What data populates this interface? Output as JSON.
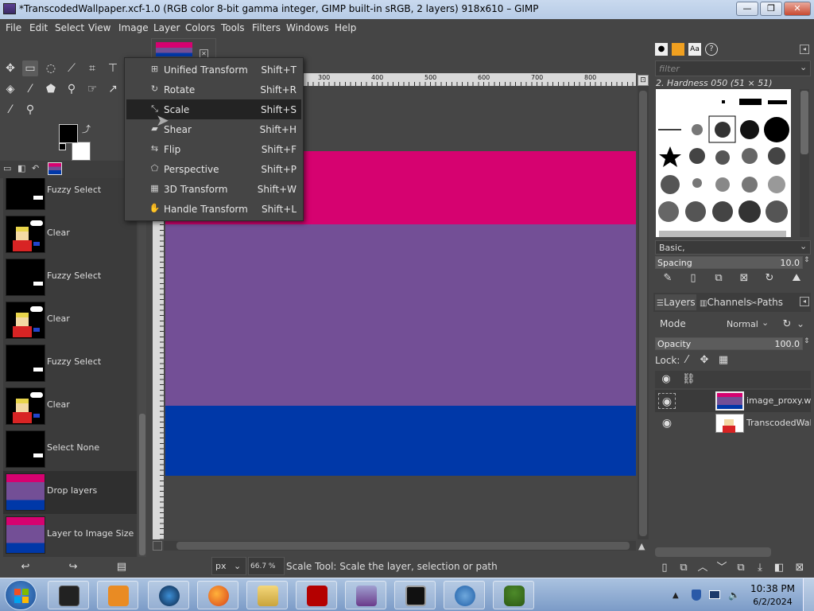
{
  "window": {
    "title": "*TranscodedWallpaper.xcf-1.0 (RGB color 8-bit gamma integer, GIMP built-in sRGB, 2 layers) 918x610 – GIMP",
    "minimize": "—",
    "maximize": "❐",
    "close": "✕"
  },
  "menubar": [
    "File",
    "Edit",
    "Select",
    "View",
    "Image",
    "Layer",
    "Colors",
    "Tools",
    "Filters",
    "Windows",
    "Help"
  ],
  "transform_menu": [
    {
      "label": "Unified Transform",
      "shortcut": "Shift+T",
      "icon": "unified-transform-icon"
    },
    {
      "label": "Rotate",
      "shortcut": "Shift+R",
      "icon": "rotate-icon"
    },
    {
      "label": "Scale",
      "shortcut": "Shift+S",
      "icon": "scale-icon",
      "highlighted": true
    },
    {
      "label": "Shear",
      "shortcut": "Shift+H",
      "icon": "shear-icon"
    },
    {
      "label": "Flip",
      "shortcut": "Shift+F",
      "icon": "flip-icon"
    },
    {
      "label": "Perspective",
      "shortcut": "Shift+P",
      "icon": "perspective-icon"
    },
    {
      "label": "3D Transform",
      "shortcut": "Shift+W",
      "icon": "3d-transform-icon"
    },
    {
      "label": "Handle Transform",
      "shortcut": "Shift+L",
      "icon": "handle-transform-icon"
    }
  ],
  "history": [
    {
      "label": "Fuzzy Select",
      "thumb": "black"
    },
    {
      "label": "Clear",
      "thumb": "character"
    },
    {
      "label": "Fuzzy Select",
      "thumb": "black"
    },
    {
      "label": "Clear",
      "thumb": "character"
    },
    {
      "label": "Fuzzy Select",
      "thumb": "black"
    },
    {
      "label": "Clear",
      "thumb": "character"
    },
    {
      "label": "Select None",
      "thumb": "black"
    },
    {
      "label": "Drop layers",
      "thumb": "flag",
      "active": true
    },
    {
      "label": "Layer to Image Size",
      "thumb": "flag"
    }
  ],
  "ruler": {
    "labels": [
      "300",
      "400",
      "500",
      "600",
      "700",
      "800"
    ]
  },
  "flag_colors": {
    "pink": "#d60270",
    "purple": "#734f96",
    "blue": "#0038a8",
    "canvas_bg": "#464646"
  },
  "status": {
    "unit": "px",
    "zoom": "66.7 %",
    "message": "Scale Tool: Scale the layer, selection or path"
  },
  "brushes": {
    "filter_placeholder": "filter",
    "selected": "2. Hardness 050 (51 × 51)",
    "preset": "Basic,",
    "spacing_label": "Spacing",
    "spacing_value": "10.0"
  },
  "layers_panel": {
    "tabs": [
      "Layers",
      "Channels",
      "Paths"
    ],
    "mode_label": "Mode",
    "mode_value": "Normal",
    "opacity_label": "Opacity",
    "opacity_value": "100.0",
    "lock_label": "Lock:",
    "layers": [
      {
        "name": "image_proxy.wel",
        "thumb": "flag",
        "selected": true
      },
      {
        "name": "TranscodedWallp",
        "thumb": "character"
      }
    ]
  },
  "taskbar": {
    "time": "10:38 PM",
    "date": "6/2/2024",
    "apps": [
      "terminal-app",
      "media-player-app",
      "network-app",
      "firefox-app",
      "file-explorer-app",
      "filezilla-app",
      "gimp-app",
      "display-app",
      "qbittorrent-app",
      "tree-app"
    ]
  }
}
